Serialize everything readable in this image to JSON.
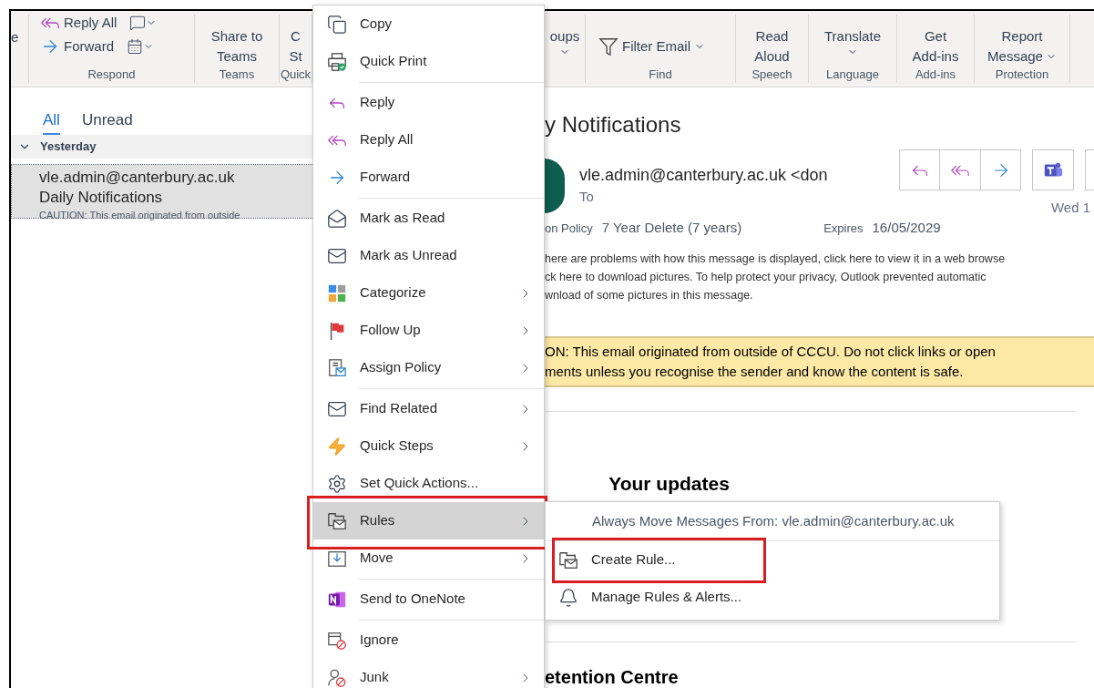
{
  "ribbon": {
    "groups": [
      {
        "kind": "cut",
        "buttons": [
          {
            "lines": [
              "e"
            ]
          }
        ]
      },
      {
        "kind": "respond",
        "label": "Respond",
        "buttons": [
          {
            "lines": [
              "Reply All"
            ]
          },
          {
            "lines": [
              "Forward"
            ]
          }
        ]
      },
      {
        "kind": "large",
        "label": "Teams",
        "buttons": [
          {
            "lines": [
              "Share to",
              "Teams"
            ]
          }
        ]
      },
      {
        "kind": "large",
        "label": "Quick",
        "buttons": [
          {
            "lines": [
              "C",
              "St"
            ]
          }
        ]
      },
      {
        "kind": "gap"
      },
      {
        "kind": "large",
        "buttons": [
          {
            "lines": [
              "oups"
            ],
            "dropdown": true
          }
        ]
      },
      {
        "kind": "find",
        "label": "Find",
        "buttons": [
          {
            "lines": [
              "Filter Email"
            ],
            "dropdown": true
          }
        ]
      },
      {
        "kind": "large",
        "label": "Speech",
        "buttons": [
          {
            "lines": [
              "Read",
              "Aloud"
            ]
          }
        ]
      },
      {
        "kind": "large",
        "label": "Language",
        "buttons": [
          {
            "lines": [
              "Translate"
            ],
            "dropdown": true
          }
        ]
      },
      {
        "kind": "large",
        "label": "Add-ins",
        "buttons": [
          {
            "lines": [
              "Get",
              "Add-ins"
            ]
          }
        ]
      },
      {
        "kind": "large",
        "label": "Protection",
        "buttons": [
          {
            "lines": [
              "Report",
              "Message"
            ],
            "dropdown": true
          }
        ]
      }
    ]
  },
  "mail_list": {
    "tabs": [
      {
        "label": "All",
        "selected": true
      },
      {
        "label": "Unread",
        "selected": false
      }
    ],
    "groups": [
      {
        "label": "Yesterday",
        "expanded": true,
        "items": [
          {
            "sender": "vle.admin@canterbury.ac.uk",
            "subject": "Daily Notifications",
            "preview": "CAUTION: This email originated from outside",
            "selected": true
          }
        ]
      }
    ]
  },
  "reading_pane": {
    "subject": "y Notifications",
    "sender": "vle.admin@canterbury.ac.uk <don",
    "to_label": "To",
    "date": "Wed 1",
    "policy_label": "on Policy",
    "policy": "7 Year Delete (7 years)",
    "expires_label": "Expires",
    "expires": "16/05/2029",
    "info_lines": [
      "here are problems with how this message is displayed, click here to view it in a web browse",
      "ck here to download pictures. To help protect your privacy, Outlook prevented automatic",
      "wnload of some pictures in this message."
    ],
    "banner_lines": [
      "ON: This email originated from outside of CCCU. Do not click links or open",
      "ments unless you recognise the sender and know the content is safe."
    ],
    "heading": "Your updates",
    "footer_heading": "etention Centre"
  },
  "context_menu": {
    "items": [
      {
        "kind": "item",
        "label": "Copy",
        "submenu": false,
        "selected": false,
        "annotated": false
      },
      {
        "kind": "item",
        "label": "Quick Print",
        "submenu": false,
        "selected": false,
        "annotated": false
      },
      {
        "kind": "separator"
      },
      {
        "kind": "item",
        "label": "Reply",
        "submenu": false,
        "selected": false,
        "annotated": false
      },
      {
        "kind": "item",
        "label": "Reply All",
        "submenu": false,
        "selected": false,
        "annotated": false
      },
      {
        "kind": "item",
        "label": "Forward",
        "submenu": false,
        "selected": false,
        "annotated": false
      },
      {
        "kind": "separator"
      },
      {
        "kind": "item",
        "label": "Mark as Read",
        "submenu": false,
        "selected": false,
        "annotated": false
      },
      {
        "kind": "item",
        "label": "Mark as Unread",
        "submenu": false,
        "selected": false,
        "annotated": false
      },
      {
        "kind": "item",
        "label": "Categorize",
        "submenu": true,
        "selected": false,
        "annotated": false
      },
      {
        "kind": "item",
        "label": "Follow Up",
        "submenu": true,
        "selected": false,
        "annotated": false
      },
      {
        "kind": "item",
        "label": "Assign Policy",
        "submenu": true,
        "selected": false,
        "annotated": false
      },
      {
        "kind": "separator"
      },
      {
        "kind": "item",
        "label": "Find Related",
        "submenu": true,
        "selected": false,
        "annotated": false
      },
      {
        "kind": "item",
        "label": "Quick Steps",
        "submenu": true,
        "selected": false,
        "annotated": false
      },
      {
        "kind": "item",
        "label": "Set Quick Actions...",
        "submenu": false,
        "selected": false,
        "annotated": false
      },
      {
        "kind": "item",
        "label": "Rules",
        "submenu": true,
        "selected": true,
        "annotated": true
      },
      {
        "kind": "item",
        "label": "Move",
        "submenu": true,
        "selected": false,
        "annotated": false
      },
      {
        "kind": "separator"
      },
      {
        "kind": "item",
        "label": "Send to OneNote",
        "submenu": false,
        "selected": false,
        "annotated": false
      },
      {
        "kind": "separator"
      },
      {
        "kind": "item",
        "label": "Ignore",
        "submenu": false,
        "selected": false,
        "annotated": false
      },
      {
        "kind": "item",
        "label": "Junk",
        "submenu": true,
        "selected": false,
        "annotated": false
      }
    ]
  },
  "submenu": {
    "items": [
      {
        "kind": "header",
        "label": "Always Move Messages From: vle.admin@canterbury.ac.uk"
      },
      {
        "kind": "separator"
      },
      {
        "kind": "item",
        "label": "Create Rule...",
        "annotated": true
      },
      {
        "kind": "item",
        "label": "Manage Rules & Alerts...",
        "annotated": false
      }
    ]
  }
}
